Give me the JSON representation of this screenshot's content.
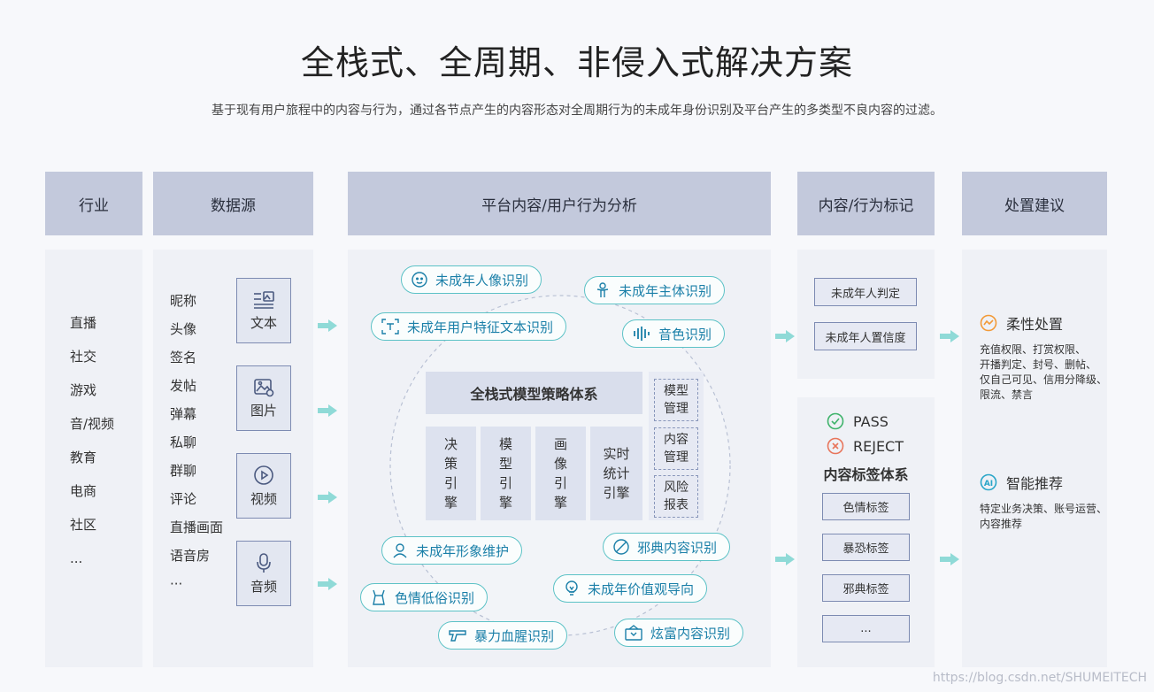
{
  "title": "全栈式、全周期、非侵入式解决方案",
  "subtitle": "基于现有用户旅程中的内容与行为，通过各节点产生的内容形态对全周期行为的未成年身份识别及平台产生的多类型不良内容的过滤。",
  "columns": {
    "industry": "行业",
    "datasource": "数据源",
    "analysis": "平台内容/用户行为分析",
    "mark": "内容/行为标记",
    "advice": "处置建议"
  },
  "industries": [
    "直播",
    "社交",
    "游戏",
    "音/视频",
    "教育",
    "电商",
    "社区",
    "..."
  ],
  "datasources": [
    "昵称",
    "头像",
    "签名",
    "发帖",
    "弹幕",
    "私聊",
    "群聊",
    "评论",
    "直播画面",
    "语音房",
    "···"
  ],
  "media": {
    "text": "文本",
    "image": "图片",
    "video": "视频",
    "audio": "音频"
  },
  "pills": {
    "p1": "未成年人像识别",
    "p2": "未成年主体识别",
    "p3": "未成年用户特征文本识别",
    "p4": "音色识别",
    "p5": "未成年形象维护",
    "p6": "邪典内容识别",
    "p7": "色情低俗识别",
    "p8": "未成年价值观导向",
    "p9": "暴力血腥识别",
    "p10": "炫富内容识别"
  },
  "core": {
    "head": "全栈式模型策略体系",
    "engines": [
      "决\n策\n引\n擎",
      "模\n型\n引\n擎",
      "画\n像\n引\n擎",
      "实时\n统计\n引擎"
    ],
    "side": [
      "模型\n管理",
      "内容\n管理",
      "风险\n报表"
    ]
  },
  "mark": {
    "judge1": "未成年人判定",
    "judge2": "未成年人置信度",
    "pass": "PASS",
    "reject": "REJECT",
    "tag_system": "内容标签体系",
    "tags": [
      "色情标签",
      "暴恐标签",
      "邪典标签",
      "..."
    ]
  },
  "advice": {
    "flex_title": "柔性处置",
    "flex_desc": "充值权限、打赏权限、\n开播判定、封号、删帖、\n仅自己可见、信用分降级、\n限流、禁言",
    "smart_title": "智能推荐",
    "smart_desc": "特定业务决策、账号运营、\n内容推荐"
  },
  "watermark": "https://blog.csdn.net/SHUMEITECH",
  "colors": {
    "accent": "#5cc2c6",
    "pill_text": "#1a7fa8",
    "header_bg": "#c3c9dc",
    "body_bg": "#eff1f6"
  }
}
